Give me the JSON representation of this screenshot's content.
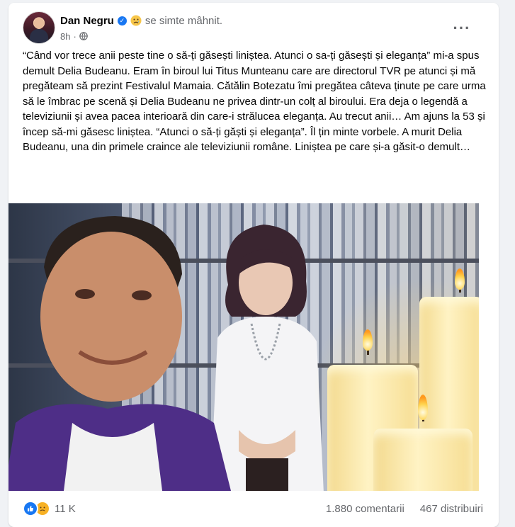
{
  "post": {
    "author": "Dan Negru",
    "feeling": "se simte mâhnit.",
    "time": "8h",
    "text": "“Când vor trece anii peste tine o să-ți găsești liniștea. Atunci o sa-ți găsești și eleganța” mi-a spus demult Delia Budeanu. Eram în biroul lui Titus Munteanu care are directorul TVR pe atunci și mă pregăteam să prezint Festivalul Mamaia. Cătălin Botezatu îmi pregătea câteva ținute pe care urma să le îmbrac pe scenă și Delia Budeanu ne privea dintr-un colț al biroului. Era deja o legendă a televiziunii și avea pacea interioară din care-i  strălucea eleganța. Au trecut anii… Am ajuns la 53 și încep să-mi găsesc liniștea. “Atunci o să-ți găști și eleganța”. Îl țin minte vorbele. A murit Delia Budeanu, una din primele craince ale televiziunii române. Liniștea pe care și-a găsit-o demult…"
  },
  "stats": {
    "reactions": "11 K",
    "comments": "1.880 comentarii",
    "shares": "467 distribuiri"
  },
  "icons": {
    "verified": "verified-badge-icon",
    "feeling": "sad-face-icon",
    "privacy": "globe-icon",
    "more": "more-options-icon",
    "reaction_like": "like-icon",
    "reaction_sad": "sad-reaction-icon"
  },
  "colors": {
    "accent": "#1877f2",
    "muted_text": "#65676b",
    "background": "#f0f2f5"
  }
}
